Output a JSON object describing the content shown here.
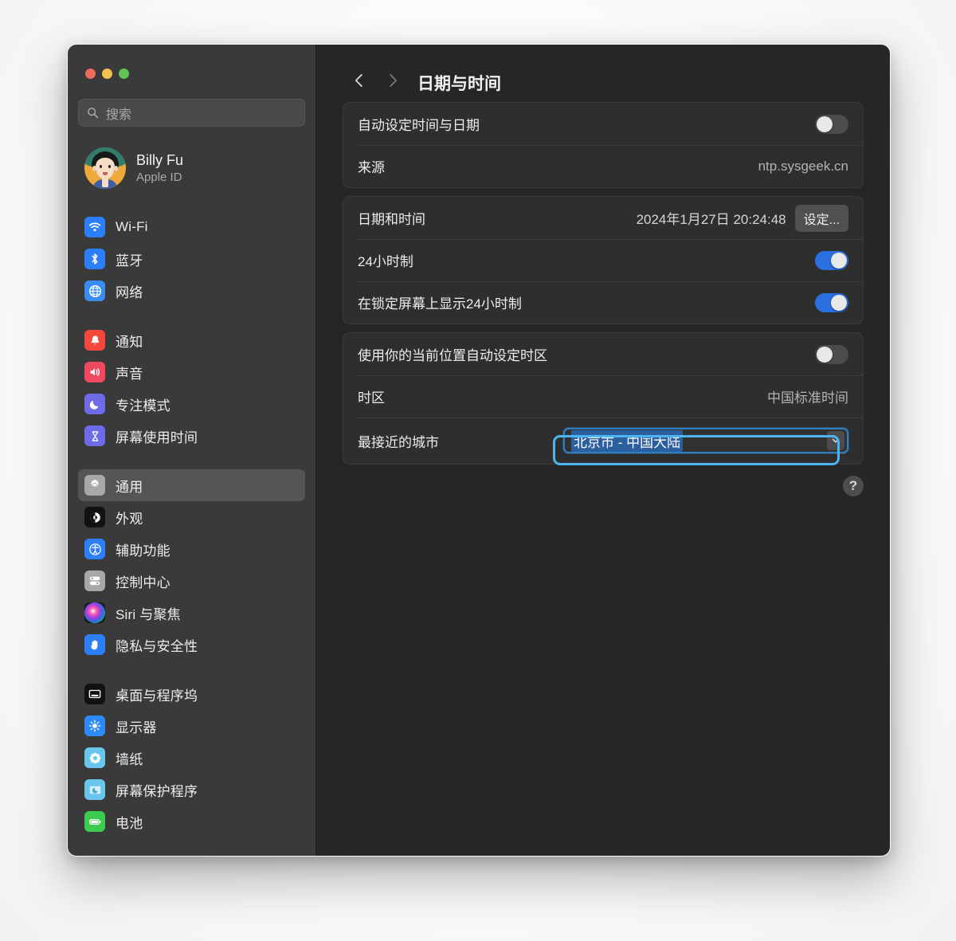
{
  "window": {
    "traffic_lights": [
      {
        "name": "close",
        "color": "#ed6a5e"
      },
      {
        "name": "minimize",
        "color": "#f5bf4f"
      },
      {
        "name": "zoom",
        "color": "#61c554"
      }
    ]
  },
  "sidebar": {
    "search": {
      "placeholder": "搜索",
      "value": ""
    },
    "account": {
      "name": "Billy Fu",
      "subtitle": "Apple ID"
    },
    "groups": [
      {
        "items": [
          {
            "label": "Wi-Fi",
            "icon": "wifi-icon",
            "selected": false
          },
          {
            "label": "蓝牙",
            "icon": "bluetooth-icon",
            "selected": false
          },
          {
            "label": "网络",
            "icon": "network-globe-icon",
            "selected": false
          }
        ]
      },
      {
        "items": [
          {
            "label": "通知",
            "icon": "notifications-bell-icon",
            "selected": false
          },
          {
            "label": "声音",
            "icon": "sound-speaker-icon",
            "selected": false
          },
          {
            "label": "专注模式",
            "icon": "focus-moon-icon",
            "selected": false
          },
          {
            "label": "屏幕使用时间",
            "icon": "screen-time-hourglass-icon",
            "selected": false
          }
        ]
      },
      {
        "items": [
          {
            "label": "通用",
            "icon": "general-gear-icon",
            "selected": true
          },
          {
            "label": "外观",
            "icon": "appearance-contrast-icon",
            "selected": false
          },
          {
            "label": "辅助功能",
            "icon": "accessibility-icon",
            "selected": false
          },
          {
            "label": "控制中心",
            "icon": "control-center-icon",
            "selected": false
          },
          {
            "label": "Siri 与聚焦",
            "icon": "siri-icon",
            "selected": false
          },
          {
            "label": "隐私与安全性",
            "icon": "privacy-hand-icon",
            "selected": false
          }
        ]
      },
      {
        "items": [
          {
            "label": "桌面与程序坞",
            "icon": "desktop-dock-icon",
            "selected": false
          },
          {
            "label": "显示器",
            "icon": "displays-brightness-icon",
            "selected": false
          },
          {
            "label": "墙纸",
            "icon": "wallpaper-flower-icon",
            "selected": false
          },
          {
            "label": "屏幕保护程序",
            "icon": "screensaver-icon",
            "selected": false
          },
          {
            "label": "电池",
            "icon": "battery-icon",
            "selected": false
          }
        ]
      }
    ]
  },
  "toolbar": {
    "back_icon": "chevron-left-icon",
    "forward_icon": "chevron-right-icon",
    "title": "日期与时间"
  },
  "main": {
    "card1": {
      "auto_datetime_label": "自动设定时间与日期",
      "auto_datetime_toggle": "off",
      "source_label": "来源",
      "source_value": "ntp.sysgeek.cn"
    },
    "card2": {
      "datetime_label": "日期和时间",
      "datetime_value": "2024年1月27日 20:24:48",
      "set_button": "设定...",
      "h24_label": "24小时制",
      "h24_toggle": "on",
      "h24_lock_label": "在锁定屏幕上显示24小时制",
      "h24_lock_toggle": "on"
    },
    "card3": {
      "auto_timezone_label": "使用你的当前位置自动设定时区",
      "auto_timezone_toggle": "off",
      "timezone_label": "时区",
      "timezone_value": "中国标准时间",
      "closest_city_label": "最接近的城市",
      "closest_city_value": "北京市 - 中国大陆",
      "closest_city_arrow": "chevron-down-icon"
    },
    "help_button": "?"
  },
  "annotations": {
    "accent_color": "#4db3f2",
    "toggles_box": "highlight-toggles-column",
    "combo_box": "highlight-closest-city"
  }
}
